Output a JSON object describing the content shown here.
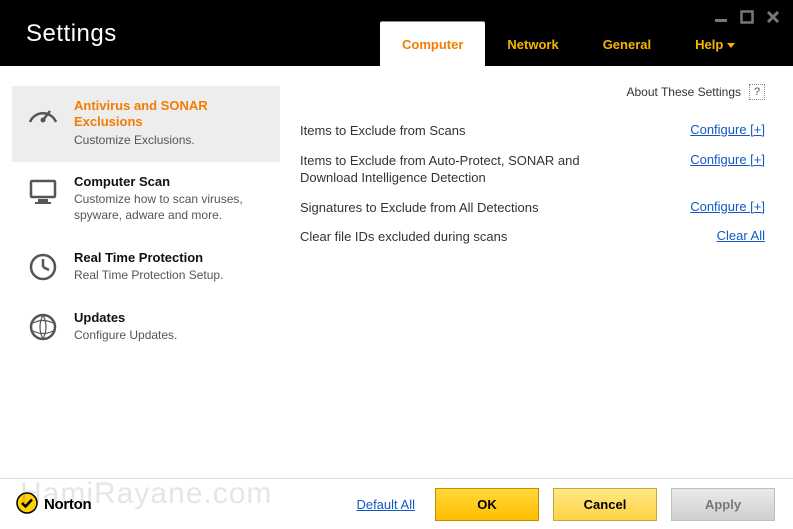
{
  "window": {
    "title": "Settings"
  },
  "tabs": {
    "computer": "Computer",
    "network": "Network",
    "general": "General",
    "help": "Help"
  },
  "sidebar": [
    {
      "title": "Antivirus and SONAR Exclusions",
      "sub": "Customize Exclusions."
    },
    {
      "title": "Computer Scan",
      "sub": "Customize how to scan viruses, spyware, adware and more."
    },
    {
      "title": "Real Time Protection",
      "sub": "Real Time Protection Setup."
    },
    {
      "title": "Updates",
      "sub": "Configure Updates."
    }
  ],
  "about": {
    "label": "About These Settings",
    "help": "?"
  },
  "rows": [
    {
      "label": "Items to Exclude from Scans",
      "action": "Configure [+]"
    },
    {
      "label": "Items to Exclude from Auto-Protect, SONAR and Download Intelligence Detection",
      "action": "Configure [+]"
    },
    {
      "label": "Signatures to Exclude from All Detections",
      "action": "Configure [+]"
    },
    {
      "label": "Clear file IDs excluded during scans",
      "action": "Clear All"
    }
  ],
  "footer": {
    "brand": "Norton",
    "default_all": "Default All",
    "ok": "OK",
    "cancel": "Cancel",
    "apply": "Apply"
  },
  "watermark": "HamiRayane.com"
}
